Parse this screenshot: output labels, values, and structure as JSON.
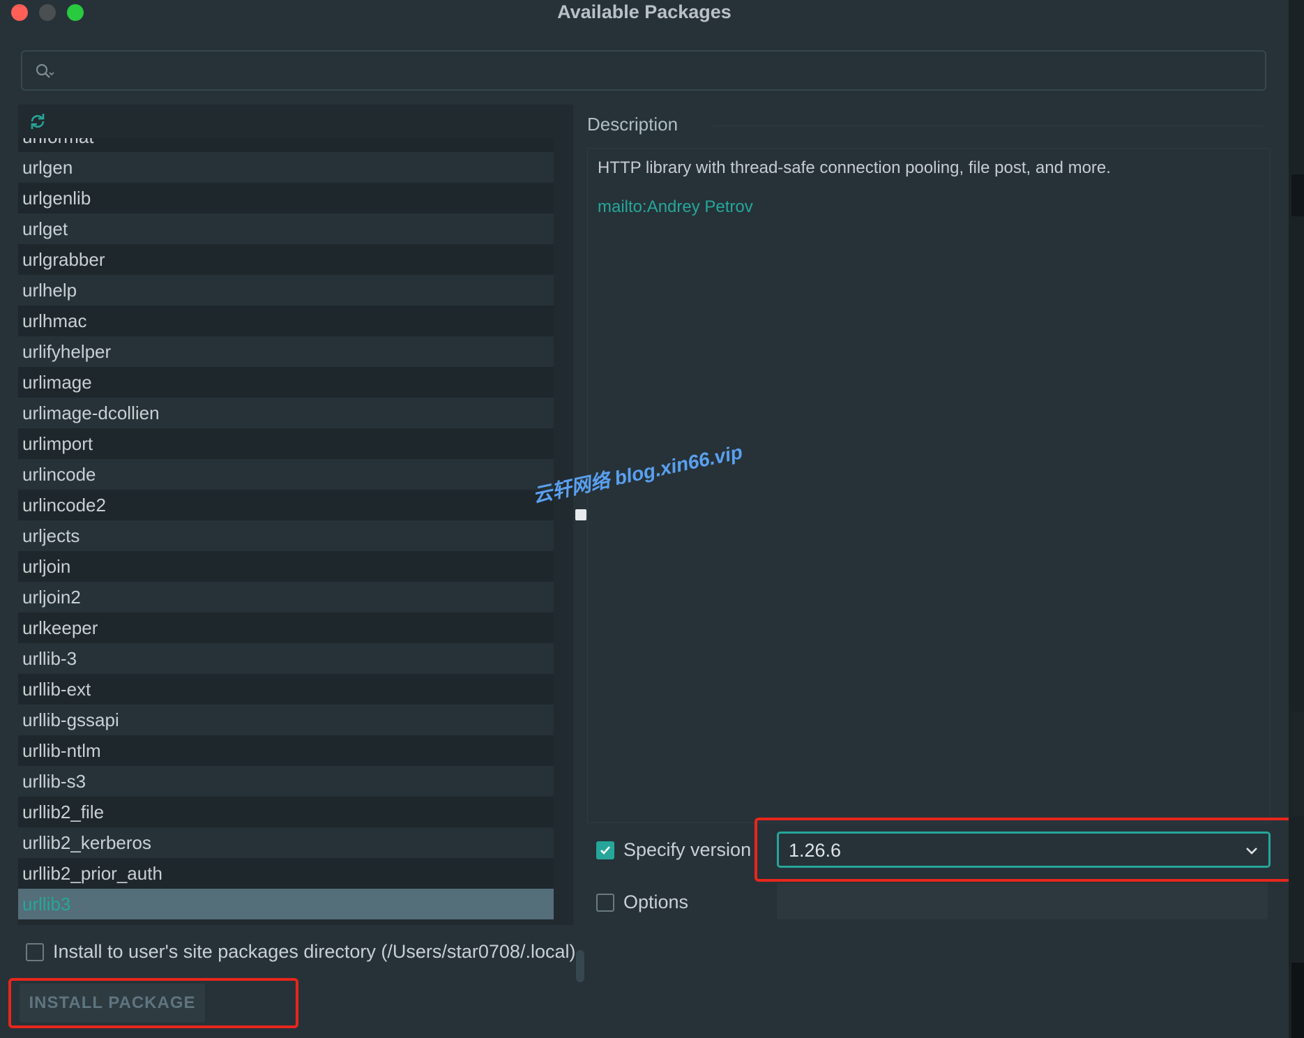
{
  "window": {
    "title": "Available Packages"
  },
  "search": {
    "value": "",
    "placeholder": ""
  },
  "packages": {
    "items": [
      "urlformat",
      "urlgen",
      "urlgenlib",
      "urlget",
      "urlgrabber",
      "urlhelp",
      "urlhmac",
      "urlifyhelper",
      "urlimage",
      "urlimage-dcollien",
      "urlimport",
      "urlincode",
      "urlincode2",
      "urljects",
      "urljoin",
      "urljoin2",
      "urlkeeper",
      "urllib-3",
      "urllib-ext",
      "urllib-gssapi",
      "urllib-ntlm",
      "urllib-s3",
      "urllib2_file",
      "urllib2_kerberos",
      "urllib2_prior_auth",
      "urllib3"
    ],
    "selected": "urllib3"
  },
  "description": {
    "title": "Description",
    "text": "HTTP library with thread-safe connection pooling, file post, and more.",
    "link": "mailto:Andrey Petrov"
  },
  "version": {
    "label": "Specify version",
    "checked": true,
    "value": "1.26.6"
  },
  "options": {
    "label": "Options",
    "checked": false,
    "value": ""
  },
  "install_to_user": {
    "label": "Install to user's site packages directory (/Users/star0708/.local)",
    "checked": false
  },
  "install_button": {
    "label": "INSTALL PACKAGE"
  },
  "watermark": {
    "text": "云轩网络 blog.xin66.vip"
  },
  "colors": {
    "accent": "#26a69a",
    "highlight": "#e8261c",
    "background": "#263238"
  }
}
